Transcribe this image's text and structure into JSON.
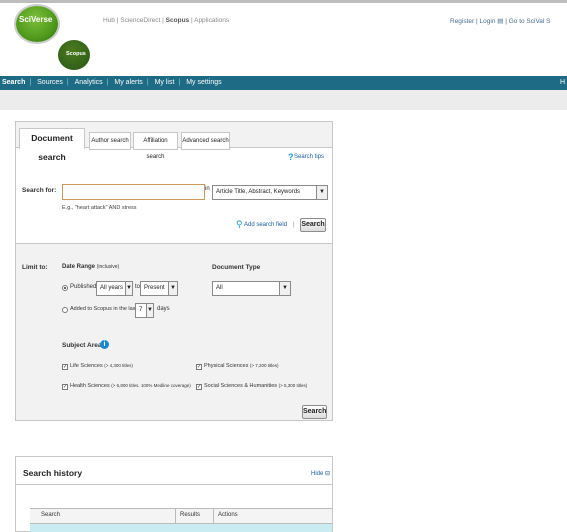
{
  "header": {
    "logo_text": "SciVerse",
    "logo_sub": "Scopus",
    "hub_links": [
      "Hub",
      "ScienceDirect",
      "Scopus",
      "Applications"
    ],
    "right_links": [
      "Register",
      "Login",
      "Go to SciVal S"
    ]
  },
  "nav": {
    "items": [
      "Search",
      "Sources",
      "Analytics",
      "My alerts",
      "My list",
      "My settings"
    ],
    "right_text": "H"
  },
  "tabs": [
    "Document search",
    "Author search",
    "Affiliation search",
    "Advanced search"
  ],
  "search": {
    "tips": "Search tips",
    "label": "Search for:",
    "value": "",
    "in_label": "in",
    "field_select": "Article Title, Abstract, Keywords",
    "hint": "E.g., \"heart attack\" AND stress",
    "add_field": "Add search field",
    "button": "Search"
  },
  "limit": {
    "label": "Limit to:",
    "date_range_label": "Date Range",
    "date_range_note": "(inclusive)",
    "published_label": "Published",
    "from_select": "All years",
    "to_label": "to",
    "to_select": "Present",
    "added_label": "Added to Scopus in the last",
    "days_select": "7",
    "days_label": "days",
    "doc_type_label": "Document Type",
    "doc_type_select": "All",
    "subject_label": "Subject Areas",
    "subjects": [
      {
        "label": "Life Sciences",
        "note": "(> 4,300 titles)",
        "checked": true
      },
      {
        "label": "Physical Sciences",
        "note": "(> 7,200 titles)",
        "checked": true
      },
      {
        "label": "Health Sciences",
        "note": "(> 6,800 titles. 100% Medline coverage)",
        "checked": true
      },
      {
        "label": "Social Sciences & Humanities",
        "note": "(> 5,300 titles)",
        "checked": true
      }
    ],
    "button": "Search"
  },
  "history": {
    "title": "Search history",
    "hide": "Hide",
    "columns": [
      "Search",
      "Results",
      "Actions"
    ]
  }
}
